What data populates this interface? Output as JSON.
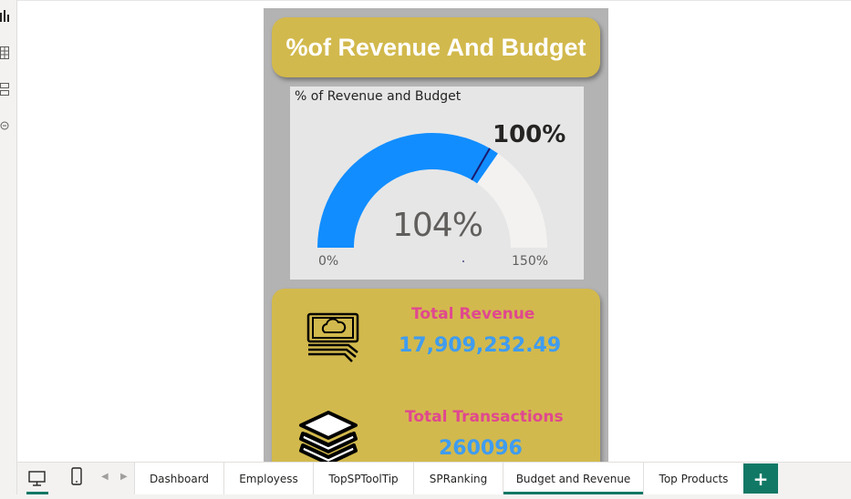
{
  "report": {
    "title": "%of Revenue And Budget",
    "gauge": {
      "title": "% of Revenue and Budget",
      "value_label": "104%",
      "target_label": "100%",
      "min_label": "0%",
      "max_label": "150%",
      "value_percent": 104,
      "target_percent": 100,
      "min_percent": 0,
      "max_percent": 150,
      "fill_color": "#118dff",
      "track_color": "#f3f2f1",
      "target_color": "#1a1a6e"
    },
    "kpis": [
      {
        "label": "Total Revenue",
        "value": "17,909,232.49",
        "icon": "money-icon"
      },
      {
        "label": "Total Transactions",
        "value": "260096",
        "icon": "layers-icon"
      }
    ]
  },
  "tabs": [
    {
      "label": "Dashboard",
      "active": false
    },
    {
      "label": "Employess",
      "active": false
    },
    {
      "label": "TopSPToolTip",
      "active": false
    },
    {
      "label": "SPRanking",
      "active": false
    },
    {
      "label": "Budget and Revenue",
      "active": true
    },
    {
      "label": "Top Products",
      "active": false
    }
  ],
  "add_tab_label": "+",
  "colors": {
    "accent": "#117865",
    "card_gold": "#d2b94d",
    "kpi_label": "#e0488f",
    "kpi_value": "#3f9cf0"
  }
}
